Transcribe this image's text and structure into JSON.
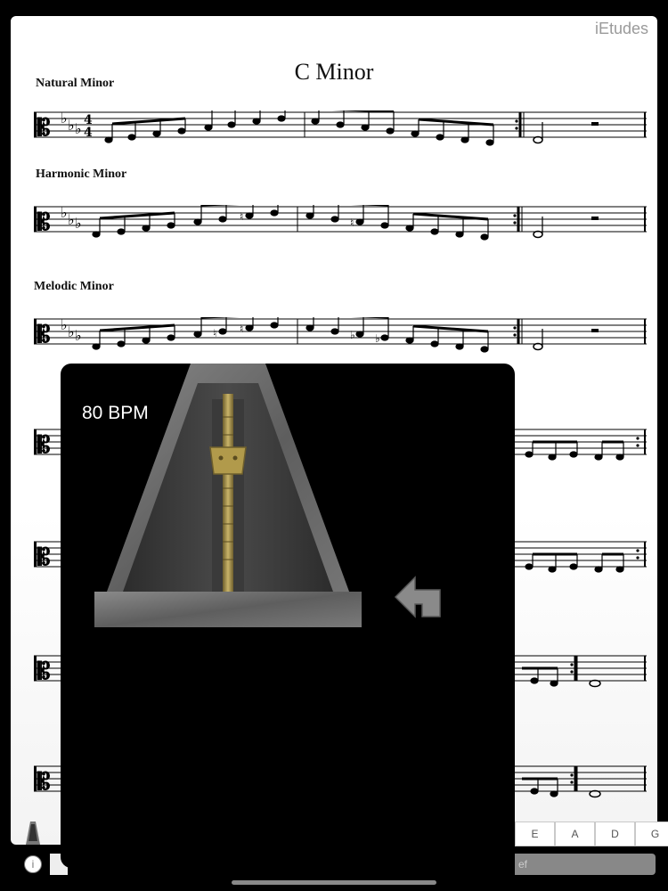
{
  "app": {
    "brand": "iEtudes",
    "title": "C Minor"
  },
  "sections": [
    {
      "label": "Natural Minor"
    },
    {
      "label": "Harmonic Minor"
    },
    {
      "label": "Melodic Minor"
    }
  ],
  "metronome": {
    "bpm_text": "80 BPM",
    "back_icon": "back-arrow-icon"
  },
  "toolbar": {
    "notes": [
      "E",
      "A",
      "D",
      "G"
    ],
    "clef_label": "ef",
    "info_label": "i"
  },
  "colors": {
    "panel": "#000000",
    "accent": "#b19a4b"
  }
}
